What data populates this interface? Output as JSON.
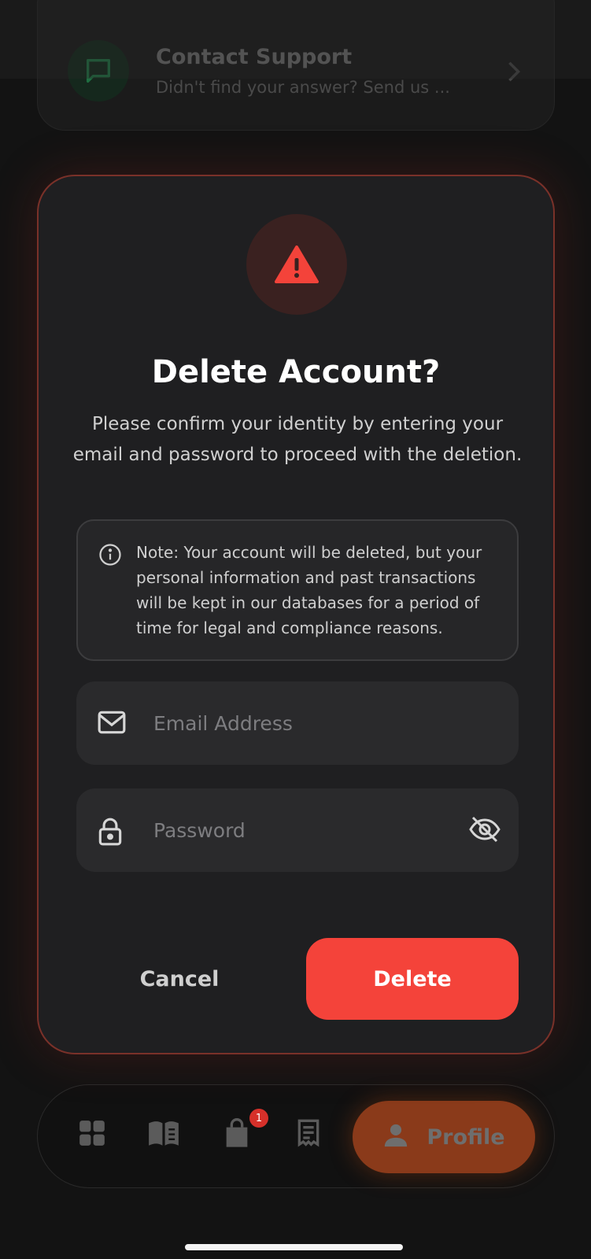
{
  "background": {
    "support": {
      "title": "Contact Support",
      "subtitle": "Didn't find your answer? Send us ...",
      "icon": "chat-bubble-icon"
    }
  },
  "modal": {
    "icon": "warning-triangle-icon",
    "title": "Delete Account?",
    "description": "Please confirm your identity by entering your email and password to proceed with the deletion.",
    "note": "Note: Your account will be deleted, but your personal information and past transactions will be kept in our databases for a period of time for legal and compliance reasons.",
    "email_placeholder": "Email Address",
    "password_placeholder": "Password",
    "cancel_label": "Cancel",
    "delete_label": "Delete"
  },
  "bottom_nav": {
    "items": [
      "grid-icon",
      "book-icon",
      "shopping-bag-icon",
      "receipt-icon",
      "profile-icon"
    ],
    "cart_badge": "1",
    "active_label": "Profile"
  },
  "colors": {
    "danger": "#f4433a",
    "modal_bg": "#1f1f21",
    "accent_orange": "#8a3a1a"
  }
}
